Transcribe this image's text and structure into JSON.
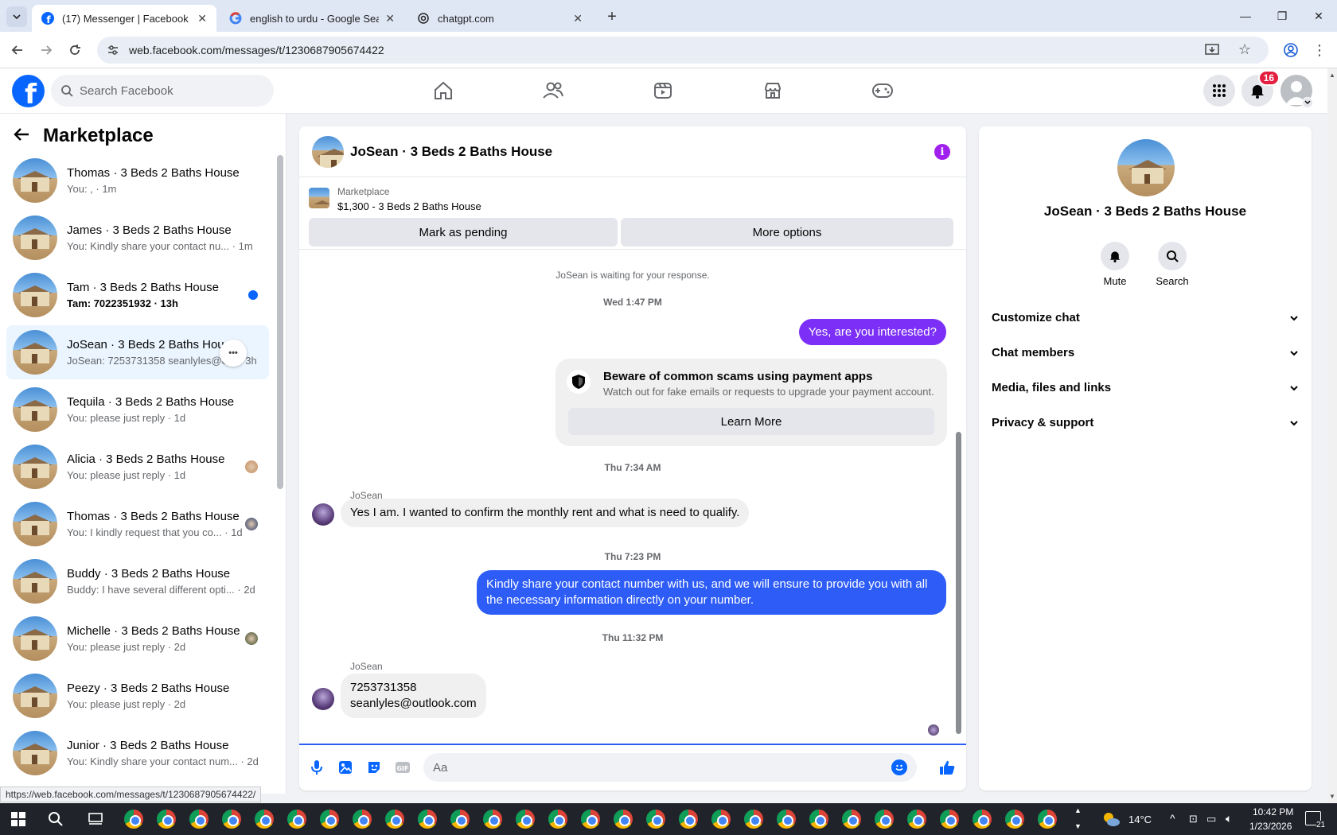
{
  "browser": {
    "tabs": [
      {
        "title": "(17) Messenger | Facebook",
        "icon": "facebook-icon",
        "active": true
      },
      {
        "title": "english to urdu - Google Search",
        "icon": "google-icon",
        "active": false
      },
      {
        "title": "chatgpt.com",
        "icon": "chatgpt-icon",
        "active": false
      }
    ],
    "url": "web.facebook.com/messages/t/1230687905674422"
  },
  "fb": {
    "search_placeholder": "Search Facebook",
    "notifications_count": "16"
  },
  "sidebar": {
    "title": "Marketplace",
    "conversations": [
      {
        "name": "Thomas · 3 Beds 2 Baths House",
        "preview": "You: , · 1m",
        "indicator": "none",
        "unread": false
      },
      {
        "name": "James · 3 Beds 2 Baths House",
        "preview": "You: Kindly share your contact nu... · 1m",
        "indicator": "none",
        "unread": false
      },
      {
        "name": "Tam · 3 Beds 2 Baths House",
        "preview": "Tam: 7022351932 · 13h",
        "indicator": "dot",
        "unread": true
      },
      {
        "name": "JoSean · 3 Beds 2 Baths House",
        "preview": "JoSean: 7253731358 seanlyles@o... · 3h",
        "indicator": "none",
        "unread": false,
        "selected": true
      },
      {
        "name": "Tequila · 3 Beds 2 Baths House",
        "preview": "You: please just reply · 1d",
        "indicator": "none",
        "unread": false
      },
      {
        "name": "Alicia · 3 Beds 2 Baths House",
        "preview": "You: please just reply · 1d",
        "indicator": "avatar",
        "unread": false
      },
      {
        "name": "Thomas · 3 Beds 2 Baths House",
        "preview": "You: I kindly request that you co... · 1d",
        "indicator": "avatar",
        "unread": false
      },
      {
        "name": "Buddy · 3 Beds 2 Baths House",
        "preview": "Buddy: I have several different opti... · 2d",
        "indicator": "none",
        "unread": false
      },
      {
        "name": "Michelle · 3 Beds 2 Baths House",
        "preview": "You: please just reply · 2d",
        "indicator": "avatar",
        "unread": false
      },
      {
        "name": "Peezy · 3 Beds 2 Baths House",
        "preview": "You: please just reply · 2d",
        "indicator": "none",
        "unread": false
      },
      {
        "name": "Junior · 3 Beds 2 Baths House",
        "preview": "You: Kindly share your contact num... · 2d",
        "indicator": "none",
        "unread": false
      }
    ]
  },
  "chat": {
    "title": "JoSean · 3 Beds 2 Baths House",
    "listing_source": "Marketplace",
    "listing_price": "$1,300 - 3 Beds 2 Baths House",
    "mark_pending": "Mark as pending",
    "more_options": "More options",
    "waiting_text": "JoSean is waiting for your response.",
    "ts1": "Wed 1:47 PM",
    "msg_out1": "Yes, are you interested?",
    "scam_title": "Beware of common scams using payment apps",
    "scam_desc": "Watch out for fake emails or requests to upgrade your payment account.",
    "learn_more": "Learn More",
    "ts2": "Thu 7:34 AM",
    "sender1": "JoSean",
    "msg_in1": "Yes I am. I wanted to confirm the monthly rent and what is need to qualify.",
    "ts3": "Thu 7:23 PM",
    "msg_out2": "Kindly share your contact number with us, and we will ensure to provide you with all the necessary information directly on your number.",
    "ts4": "Thu 11:32 PM",
    "sender2": "JoSean",
    "msg_in2_line1": "7253731358",
    "msg_in2_line2": "seanlyles@outlook.com",
    "composer_placeholder": "Aa"
  },
  "info_panel": {
    "name": "JoSean · 3 Beds 2 Baths House",
    "mute": "Mute",
    "search": "Search",
    "rows": [
      "Customize chat",
      "Chat members",
      "Media, files and links",
      "Privacy & support"
    ]
  },
  "status_url": "https://web.facebook.com/messages/t/1230687905674422/",
  "taskbar": {
    "temperature": "14°C",
    "time": "10:42 PM",
    "date": "1/23/2026",
    "notif_count": "21"
  },
  "colors": {
    "fb_blue": "#0866ff",
    "bubble_purple": "#7b2ff7",
    "bubble_blue": "#2d5cf6",
    "badge_red": "#e41e3f"
  }
}
